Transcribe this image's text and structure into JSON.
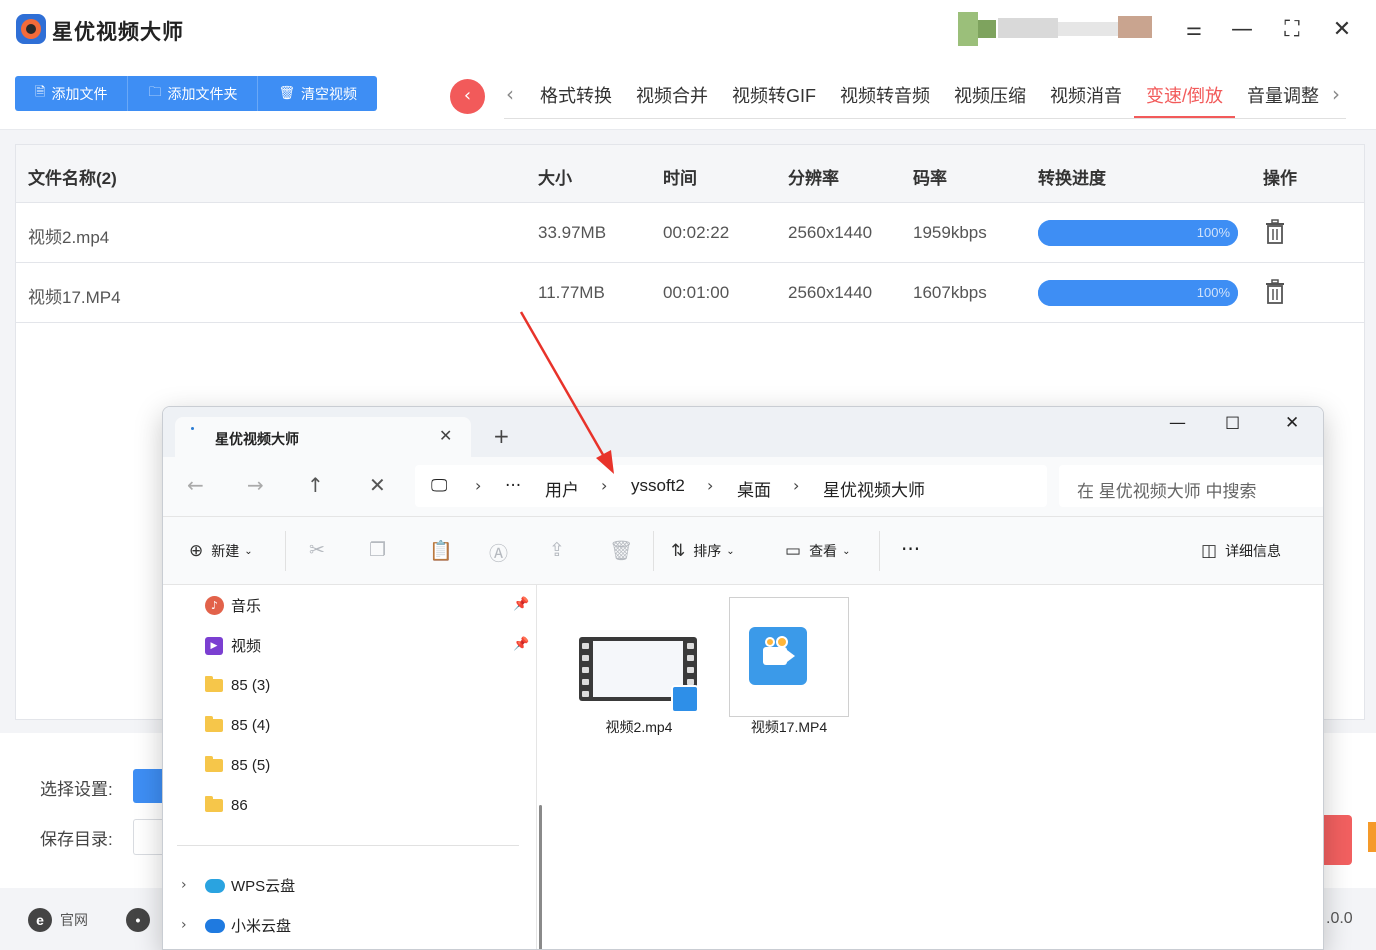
{
  "app": {
    "title": "星优视频大师",
    "toolbar_buttons": [
      "添加文件",
      "添加文件夹",
      "清空视频"
    ],
    "tabs": [
      "格式转换",
      "视频合并",
      "视频转GIF",
      "视频转音频",
      "视频压缩",
      "视频消音",
      "变速/倒放",
      "音量调整"
    ],
    "active_tab": "变速/倒放",
    "accent": "#f25a5a",
    "primary": "#3e8ef4"
  },
  "table": {
    "headers": [
      "文件名称(2)",
      "大小",
      "时间",
      "分辨率",
      "码率",
      "转换进度",
      "操作"
    ],
    "rows": [
      {
        "name": "视频2.mp4",
        "size": "33.97MB",
        "duration": "00:02:22",
        "resolution": "2560x1440",
        "bitrate": "1959kbps",
        "progress": 1.0,
        "progress_label": "100%"
      },
      {
        "name": "视频17.MP4",
        "size": "11.77MB",
        "duration": "00:01:00",
        "resolution": "2560x1440",
        "bitrate": "1607kbps",
        "progress": 1.0,
        "progress_label": "100%"
      }
    ]
  },
  "settings": {
    "select_label": "选择设置:",
    "save_label": "保存目录:"
  },
  "footer": {
    "site_label": "官网",
    "version_fragment": ".0.0"
  },
  "explorer": {
    "tab_title": "星优视频大师",
    "breadcrumb": [
      "用户",
      "yssoft2",
      "桌面",
      "星优视频大师"
    ],
    "search_placeholder": "在 星优视频大师 中搜索",
    "commands": {
      "new": "新建",
      "sort": "排序",
      "view": "查看",
      "details": "详细信息"
    },
    "sidebar": [
      {
        "label": "音乐",
        "icon": "music-icon",
        "pinned": true
      },
      {
        "label": "视频",
        "icon": "video-icon",
        "pinned": true
      },
      {
        "label": "85 (3)",
        "icon": "folder-icon"
      },
      {
        "label": "85 (4)",
        "icon": "folder-icon"
      },
      {
        "label": "85 (5)",
        "icon": "folder-icon"
      },
      {
        "label": "86",
        "icon": "folder-icon"
      }
    ],
    "cloud": [
      {
        "label": "WPS云盘",
        "icon": "wps-cloud-icon"
      },
      {
        "label": "小米云盘",
        "icon": "xiaomi-cloud-icon"
      }
    ],
    "files": [
      {
        "name": "视频2.mp4",
        "icon": "video-thumbnail-icon"
      },
      {
        "name": "视频17.MP4",
        "icon": "app-video-icon",
        "selected": true
      }
    ]
  }
}
